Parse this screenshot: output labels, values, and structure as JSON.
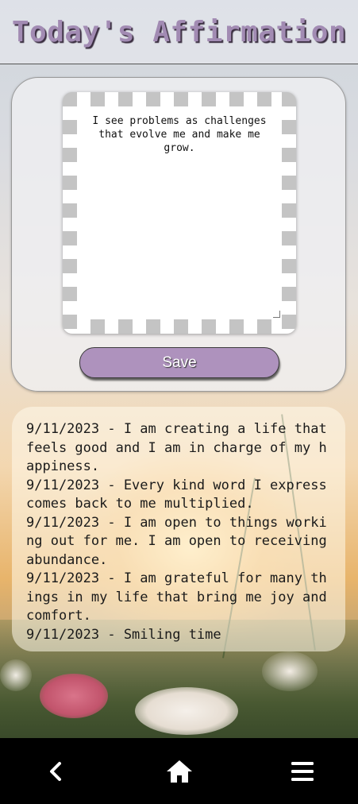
{
  "header": {
    "title": "Today's Affirmation"
  },
  "editor": {
    "text": "I see problems as challenges that evolve me and make me grow.",
    "save_label": "Save"
  },
  "log": {
    "entries": [
      "9/11/2023 - I am creating a life that feels good and I am in charge of my happiness.",
      "9/11/2023 - Every kind word I express comes back to me multiplied.",
      "9/11/2023 - I am open to things working out for me. I am open to receiving abundance.",
      "9/11/2023 - I am grateful for many things in my life that bring me joy and comfort.",
      "9/11/2023 - Smiling time"
    ]
  },
  "navbar": {
    "back_icon": "chevron-left-icon",
    "home_icon": "home-icon",
    "menu_icon": "hamburger-menu-icon"
  },
  "colors": {
    "accent": "#ae92bd",
    "title": "#a28bb3",
    "navbar": "#000000"
  }
}
